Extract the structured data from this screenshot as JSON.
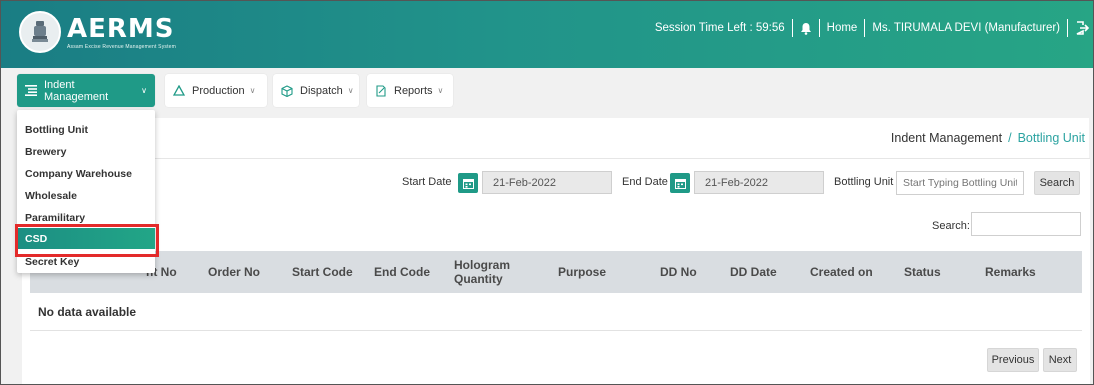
{
  "app": {
    "logo_title": "AERMS",
    "logo_subtitle": "Assam Excise Revenue Management System"
  },
  "header": {
    "session_label": "Session Time Left : 59:56",
    "home_label": "Home",
    "user_label": "Ms. TIRUMALA DEVI (Manufacturer)",
    "icons": [
      "bell-icon",
      "logout-icon"
    ]
  },
  "menu": [
    {
      "label": "Indent Management",
      "icon": "list-icon",
      "active": true
    },
    {
      "label": "Production",
      "icon": "triangle-icon",
      "active": false
    },
    {
      "label": "Dispatch",
      "icon": "box-icon",
      "active": false
    },
    {
      "label": "Reports",
      "icon": "report-icon",
      "active": false
    }
  ],
  "dropdown": {
    "items": [
      "Bottling Unit",
      "Brewery",
      "Company Warehouse",
      "Wholesale",
      "Paramilitary",
      "CSD",
      "Secret Key"
    ],
    "selected": "CSD"
  },
  "breadcrumb": {
    "parent": "Indent Management",
    "separator": "/",
    "current": "Bottling Unit"
  },
  "filters": {
    "start_date_label": "Start Date",
    "start_date_value": "21-Feb-2022",
    "end_date_label": "End Date",
    "end_date_value": "21-Feb-2022",
    "bottling_unit_label": "Bottling Unit",
    "bottling_unit_placeholder": "Start Typing Bottling Unit",
    "search_button": "Search"
  },
  "table": {
    "search_label": "Search:",
    "columns": [
      "nt No",
      "Order No",
      "Start Code",
      "End Code",
      "Hologram Quantity",
      "Purpose",
      "DD No",
      "DD Date",
      "Created on",
      "Status",
      "Remarks"
    ],
    "empty_message": "No data available"
  },
  "pagination": {
    "previous": "Previous",
    "next": "Next"
  },
  "colors": {
    "header_gradient_start": "#1a7d84",
    "header_gradient_end": "#27a585",
    "accent": "#1f9a87",
    "breadcrumb_current": "#2ba3a1",
    "highlight_box": "#e32a2a"
  }
}
